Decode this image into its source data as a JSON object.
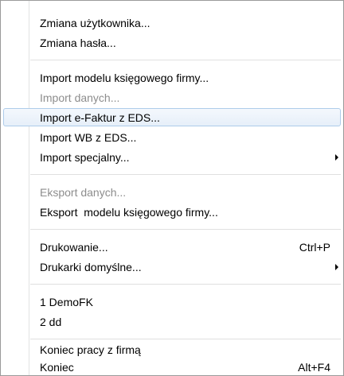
{
  "menu": {
    "items": [
      {
        "label": "Zmiana użytkownika..."
      },
      {
        "label": "Zmiana hasła..."
      },
      {
        "label": "Import modelu księgowego firmy..."
      },
      {
        "label": "Import danych...",
        "state": "disabled"
      },
      {
        "label": "Import e-Faktur z EDS...",
        "state": "highlighted"
      },
      {
        "label": "Import WB z EDS..."
      },
      {
        "label": "Import specjalny...",
        "submenu": "arrow-right-icon"
      },
      {
        "label": "Eksport danych...",
        "state": "disabled"
      },
      {
        "label": "Eksport  modelu księgowego firmy..."
      },
      {
        "label": "Drukowanie...",
        "shortcut": "Ctrl+P"
      },
      {
        "label": "Drukarki domyślne...",
        "submenu": "arrow-right-icon"
      },
      {
        "label": "1 DemoFK"
      },
      {
        "label": "2 dd"
      },
      {
        "label": "Koniec pracy z firmą"
      },
      {
        "label": "Koniec",
        "shortcut": "Alt+F4"
      }
    ]
  },
  "colors": {
    "highlight_border": "#aeccea",
    "highlight_fill": "#e6eff9",
    "disabled_text": "#8d8d8d",
    "menu_border": "#9a9a9a"
  }
}
